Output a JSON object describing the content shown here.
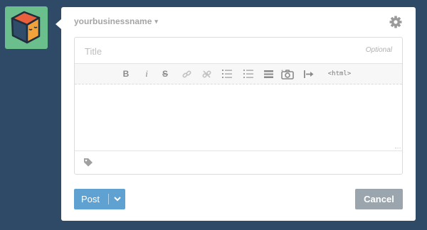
{
  "avatar": {
    "icon": "cube-face-icon"
  },
  "blog": {
    "name": "yourbusinessname",
    "caret": "▾"
  },
  "settings": {
    "icon": "gear-icon"
  },
  "editor": {
    "title_placeholder": "Title",
    "title_value": "",
    "title_optional_label": "Optional",
    "body_value": "",
    "toolbar": {
      "bold": "B",
      "italic": "i",
      "strikethrough": "S",
      "link_icon": "link-icon",
      "unlink_icon": "unlink-icon",
      "ordered_list_icon": "ordered-list-icon",
      "unordered_list_icon": "unordered-list-icon",
      "read_more_icon": "read-more-icon",
      "insert_image_icon": "camera-icon",
      "insert_arrow_icon": "insert-break-icon",
      "html": "<html>"
    },
    "tags_icon": "tag-icon"
  },
  "actions": {
    "post_label": "Post",
    "post_dropdown_icon": "chevron-down-icon",
    "cancel_label": "Cancel"
  },
  "colors": {
    "background": "#2e4a66",
    "avatar_bg": "#6bbf8c",
    "post_button": "#5fa2d1",
    "cancel_button": "#9aa5ad"
  }
}
